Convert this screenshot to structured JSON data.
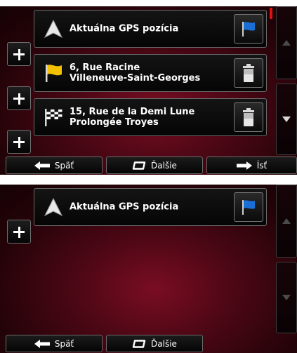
{
  "screens": [
    {
      "route": [
        {
          "lines": [
            "Aktuálna GPS pozícia"
          ],
          "icon": "gps-arrow-icon",
          "action_icon": "blue-flag-icon"
        },
        {
          "lines": [
            "6, Rue Racine",
            "Villeneuve-Saint-Georges"
          ],
          "icon": "yellow-flag-icon",
          "action_icon": "trash-icon"
        },
        {
          "lines": [
            "15, Rue de la Demi Lune",
            "Prolongée Troyes"
          ],
          "icon": "checkered-flag-icon",
          "action_icon": "trash-icon"
        }
      ],
      "buttons": {
        "back": "Späť",
        "more": "Ďalšie",
        "go": "Ísť"
      }
    },
    {
      "route": [
        {
          "lines": [
            "Aktuálna GPS pozícia"
          ],
          "icon": "gps-arrow-icon",
          "action_icon": "blue-flag-icon"
        }
      ],
      "buttons": {
        "back": "Späť",
        "more": "Ďalšie"
      }
    }
  ],
  "colors": {
    "accent_red": "#e01010",
    "flag_blue": "#1a6fd6",
    "flag_yellow": "#f2c200"
  }
}
